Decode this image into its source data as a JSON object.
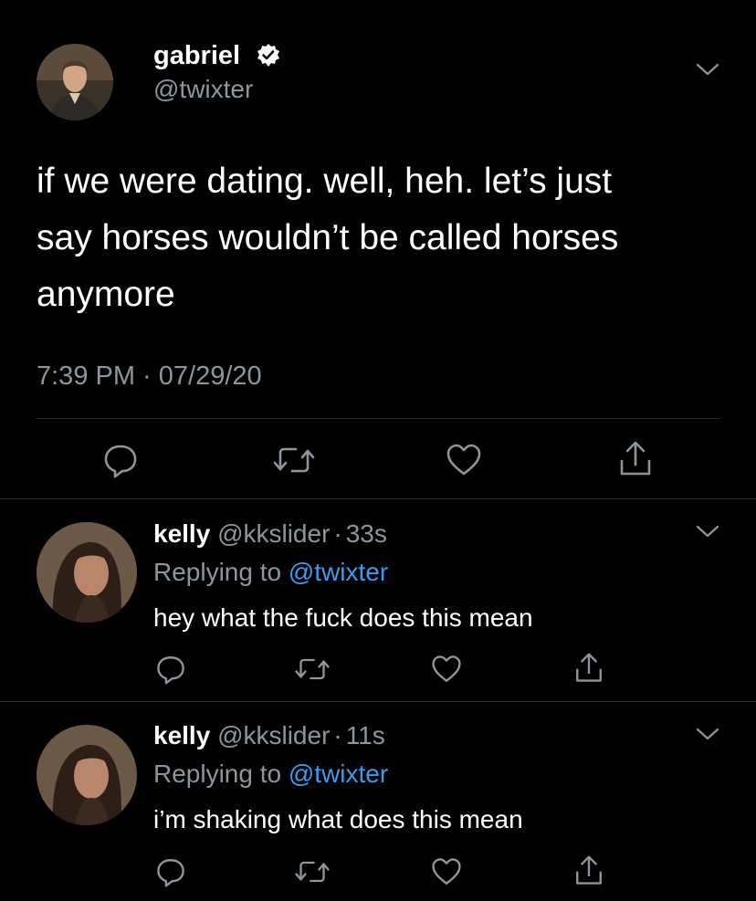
{
  "main_tweet": {
    "display_name": "gabriel",
    "handle": "@twixter",
    "verified": true,
    "text_line1": "if we were dating. well, heh. let’s just",
    "text_line2": "say horses wouldn’t be called horses",
    "text_line3": "anymore",
    "timestamp": "7:39 PM · 07/29/20"
  },
  "replies": [
    {
      "display_name": "kelly",
      "handle": "@kkslider",
      "sep": "·",
      "time": "33s",
      "replying_prefix": "Replying to",
      "replying_to": "@twixter",
      "text": "hey what the fuck does this mean"
    },
    {
      "display_name": "kelly",
      "handle": "@kkslider",
      "sep": "·",
      "time": "11s",
      "replying_prefix": "Replying to",
      "replying_to": "@twixter",
      "text": "i’m shaking what does this mean"
    }
  ],
  "icons": [
    "verified-badge-icon",
    "chevron-down-icon",
    "reply-icon",
    "retweet-icon",
    "like-icon",
    "share-icon"
  ],
  "colors": {
    "background": "#000000",
    "text": "#ffffff",
    "muted": "#8e959c",
    "link": "#3a9cf0",
    "divider": "#2a2e33"
  }
}
